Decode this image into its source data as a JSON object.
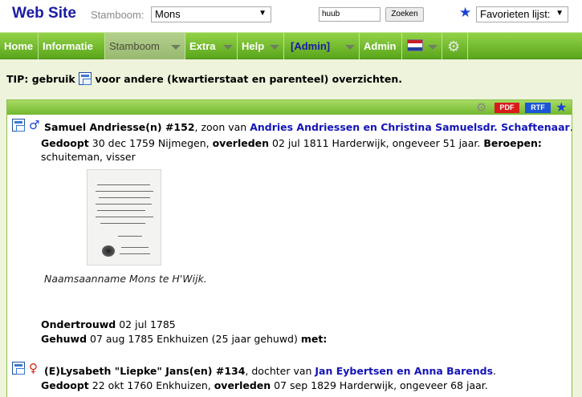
{
  "topbar": {
    "site_title": "Web Site",
    "stamboom_label": "Stamboom:",
    "tree_select_value": "Mons",
    "search_value": "huub",
    "search_button": "Zoeken",
    "favorites_value": "Favorieten lijst:"
  },
  "menu": {
    "items": [
      {
        "label": "Home"
      },
      {
        "label": "Informatie"
      },
      {
        "label": "Stamboom"
      },
      {
        "label": "Extra"
      },
      {
        "label": "Help"
      },
      {
        "label": "[Admin]"
      },
      {
        "label": "Admin"
      }
    ]
  },
  "tip": {
    "prefix": "TIP: gebruik",
    "suffix": "voor andere (kwartierstaat en parenteel) overzichten."
  },
  "panel": {
    "pdf_label": "PDF",
    "rtf_label": "RTF",
    "person1": {
      "name": "Samuel Andriesse(n) #152",
      "relation": ", zoon van ",
      "parents": "Andries Andriessen en Christina Samuelsdr. Schaftenaar",
      "parents_end": ".",
      "gedoopt_label": "Gedoopt",
      "gedoopt_value": " 30 dec 1759 Nijmegen, ",
      "overleden_label": "overleden",
      "overleden_value": " 02 jul 1811 Harderwijk, ongeveer 51 jaar. ",
      "beroepen_label": "Beroepen:",
      "beroepen_value": "schuiteman, visser"
    },
    "image_caption": "Naamsaanname Mons te H'Wijk.",
    "marriage": {
      "ondertrouwd_label": "Ondertrouwd",
      "ondertrouwd_value": " 02 jul 1785",
      "gehuwd_label": "Gehuwd",
      "gehuwd_value": " 07 aug 1785 Enkhuizen (25 jaar gehuwd) ",
      "met_label": "met:"
    },
    "person2": {
      "name": "(E)Lysabeth \"Liepke\" Jans(en) #134",
      "relation": ", dochter van ",
      "parents": "Jan Eybertsen en Anna Barends",
      "parents_end": ".",
      "gedoopt_label": "Gedoopt",
      "gedoopt_value": " 22 okt 1760 Enkhuizen, ",
      "overleden_label": "overleden",
      "overleden_value": " 07 sep 1829 Harderwijk, ongeveer 68 jaar."
    }
  },
  "colors": {
    "menu_green": "#6fbb2b",
    "link_blue": "#1414b8",
    "pdf_red": "#d81c1c",
    "rtf_blue": "#1c55d8"
  }
}
